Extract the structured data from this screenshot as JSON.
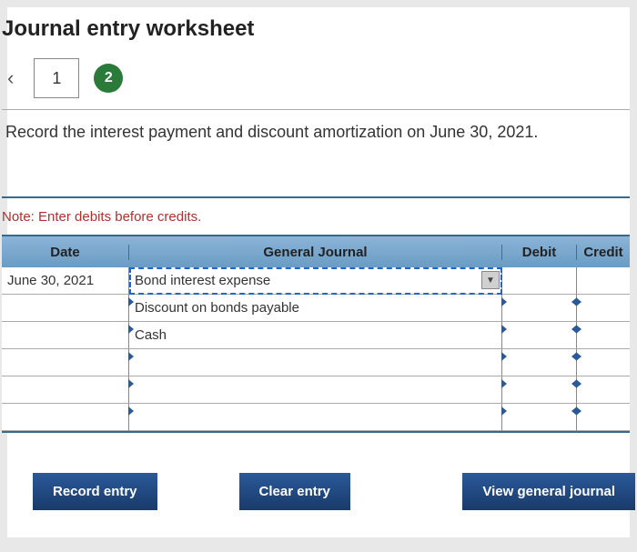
{
  "title": "Journal entry worksheet",
  "tabs": {
    "prev_icon": "‹",
    "tab1": "1",
    "tab2": "2"
  },
  "instruction": "Record the interest payment and discount amortization on June 30, 2021.",
  "note": "Note: Enter debits before credits.",
  "headers": {
    "date": "Date",
    "journal": "General Journal",
    "debit": "Debit",
    "credit": "Credit"
  },
  "rows": [
    {
      "date": "June 30, 2021",
      "journal": "Bond interest expense",
      "debit": "",
      "credit": ""
    },
    {
      "date": "",
      "journal": "Discount on bonds payable",
      "debit": "",
      "credit": ""
    },
    {
      "date": "",
      "journal": "Cash",
      "debit": "",
      "credit": ""
    },
    {
      "date": "",
      "journal": "",
      "debit": "",
      "credit": ""
    },
    {
      "date": "",
      "journal": "",
      "debit": "",
      "credit": ""
    },
    {
      "date": "",
      "journal": "",
      "debit": "",
      "credit": ""
    }
  ],
  "buttons": {
    "record": "Record entry",
    "clear": "Clear entry",
    "view": "View general journal"
  }
}
